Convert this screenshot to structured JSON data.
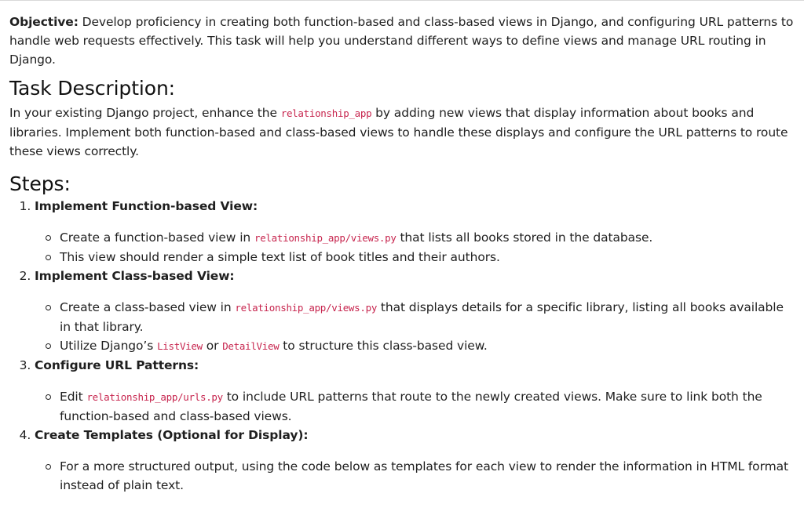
{
  "objective": {
    "label": "Objective:",
    "text": " Develop proficiency in creating both function-based and class-based views in Django, and configuring URL patterns to handle web requests effectively. This task will help you understand different ways to define views and manage URL routing in Django."
  },
  "task_description": {
    "heading": "Task Description:",
    "text_before": "In your existing Django project, enhance the ",
    "code": "relationship_app",
    "text_after": " by adding new views that display information about books and libraries. Implement both function-based and class-based views to handle these displays and configure the URL patterns to route these views correctly."
  },
  "steps": {
    "heading": "Steps:",
    "items": [
      {
        "title": "Implement Function-based View:",
        "bullets": [
          {
            "before": "Create a function-based view in ",
            "code": "relationship_app/views.py",
            "after": " that lists all books stored in the database."
          },
          {
            "text": "This view should render a simple text list of book titles and their authors."
          }
        ]
      },
      {
        "title": "Implement Class-based View:",
        "bullets": [
          {
            "before": "Create a class-based view in ",
            "code": "relationship_app/views.py",
            "after": " that displays details for a specific library, listing all books available in that library."
          },
          {
            "before": "Utilize Django’s ",
            "code1": "ListView",
            "mid": " or ",
            "code2": "DetailView",
            "after": " to structure this class-based view."
          }
        ]
      },
      {
        "title": "Configure URL Patterns:",
        "bullets": [
          {
            "before": "Edit ",
            "code": "relationship_app/urls.py",
            "after": " to include URL patterns that route to the newly created views. Make sure to link both the function-based and class-based views."
          }
        ]
      },
      {
        "title": "Create Templates (Optional for Display):",
        "bullets": [
          {
            "text": "For a more structured output, using the code below as templates for each view to render the information in HTML format instead of plain text."
          }
        ]
      }
    ]
  }
}
